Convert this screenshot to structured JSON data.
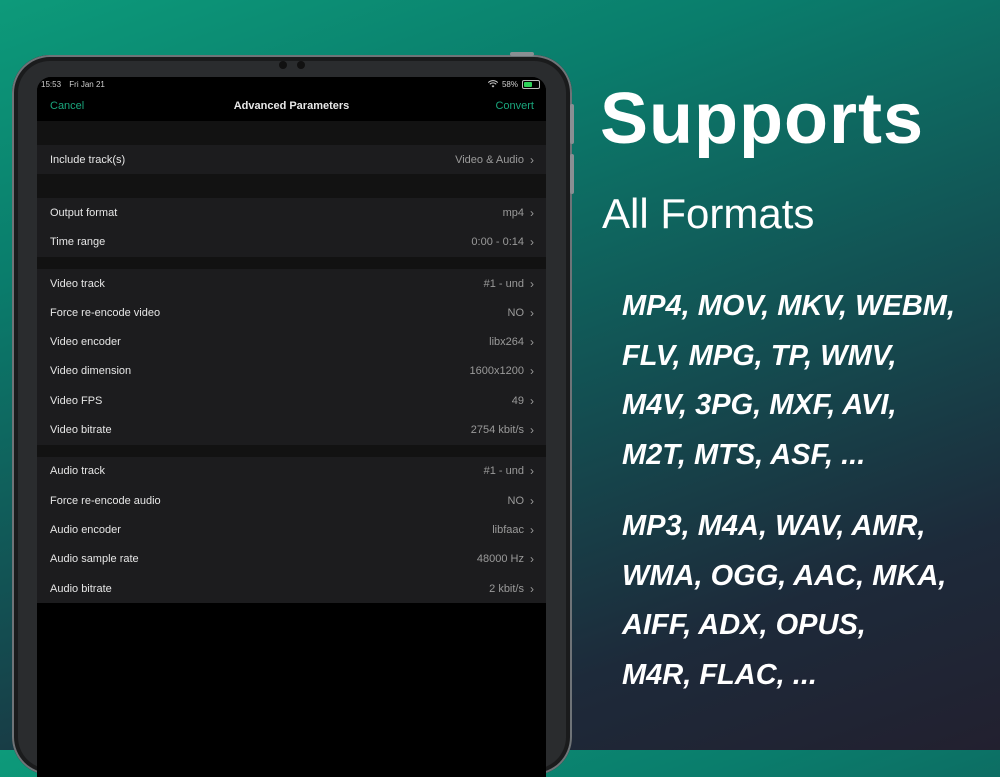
{
  "status": {
    "time": "15:53",
    "date": "Fri Jan 21",
    "battery": "58%",
    "battery_level": 0.58,
    "battery_color": "#2fd25a"
  },
  "nav": {
    "cancel": "Cancel",
    "title": "Advanced Parameters",
    "convert": "Convert",
    "accent": "#1aa67d"
  },
  "sections": {
    "general": [
      {
        "label": "Include track(s)",
        "value": "Video & Audio"
      }
    ],
    "output": [
      {
        "label": "Output format",
        "value": "mp4"
      },
      {
        "label": "Time range",
        "value": "0:00 - 0:14"
      }
    ],
    "video": [
      {
        "label": "Video track",
        "value": "#1 - und"
      },
      {
        "label": "Force re-encode video",
        "value": "NO"
      },
      {
        "label": "Video encoder",
        "value": "libx264"
      },
      {
        "label": "Video dimension",
        "value": "1600x1200"
      },
      {
        "label": "Video FPS",
        "value": "49"
      },
      {
        "label": "Video bitrate",
        "value": "2754 kbit/s"
      }
    ],
    "audio": [
      {
        "label": "Audio track",
        "value": "#1 - und"
      },
      {
        "label": "Force re-encode audio",
        "value": "NO"
      },
      {
        "label": "Audio encoder",
        "value": "libfaac"
      },
      {
        "label": "Audio sample rate",
        "value": "48000 Hz"
      },
      {
        "label": "Audio bitrate",
        "value": "2 kbit/s"
      }
    ]
  },
  "chevron_icon": "chevron-right-icon",
  "promo": {
    "title": "Supports",
    "subtitle": "All Formats",
    "video_formats": [
      "MP4, MOV, MKV, WEBM,",
      "FLV, MPG, TP, WMV,",
      "M4V, 3PG, MXF, AVI,",
      "M2T, MTS, ASF, ..."
    ],
    "audio_formats": [
      "MP3, M4A, WAV, AMR,",
      "WMA, OGG, AAC, MKA,",
      "AIFF, ADX, OPUS,",
      "M4R, FLAC, ..."
    ]
  }
}
